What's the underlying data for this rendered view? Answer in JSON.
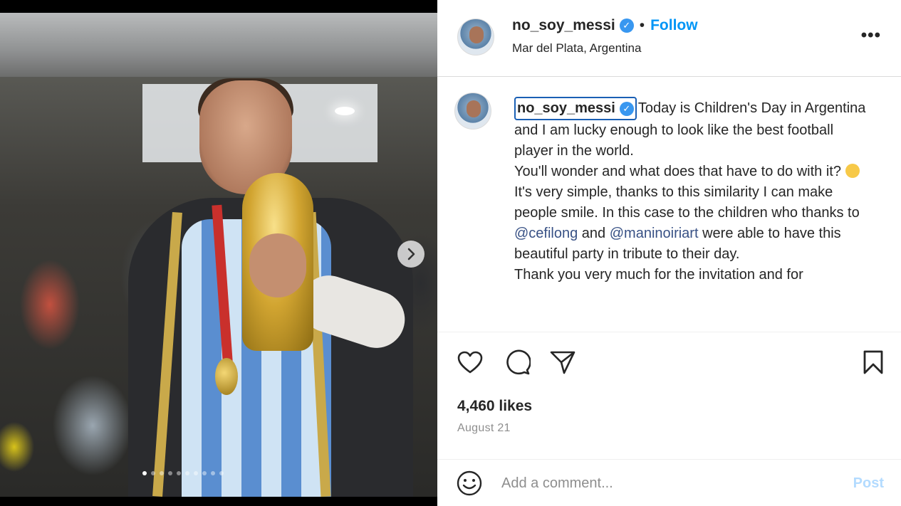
{
  "post": {
    "media": {
      "slide_count": 10,
      "active_index": 0
    },
    "header": {
      "username": "no_soy_messi",
      "separator": "•",
      "follow_label": "Follow",
      "location": "Mar del Plata, Argentina",
      "more_label": "•••"
    },
    "caption": {
      "username": "no_soy_messi",
      "text_1": "Today is Children's Day in Argentina and I am lucky enough to look like the best football player in the world.",
      "text_2": "You'll wonder and what does that have to do with it? ",
      "text_3a": "It's very simple, thanks to this similarity I can make people smile. In this case to the children who thanks to ",
      "mention_1": "@cefilong",
      "text_3b": " and ",
      "mention_2": "@maninoiriart",
      "text_3c": " were able to have this beautiful party in tribute to their day.",
      "text_4": "Thank you very much for the invitation and for"
    },
    "likes": "4,460 likes",
    "date": "August 21",
    "comment": {
      "placeholder": "Add a comment...",
      "value": "",
      "post_label": "Post"
    }
  },
  "icons": [
    "heart-icon",
    "comment-icon",
    "share-icon",
    "bookmark-icon",
    "smiley-icon",
    "chevron-right-icon",
    "verified-icon"
  ],
  "colors": {
    "follow": "#0095f6",
    "verified": "#3897f0",
    "post_disabled": "#b3dbff",
    "secondary_text": "#8e8e8e"
  }
}
